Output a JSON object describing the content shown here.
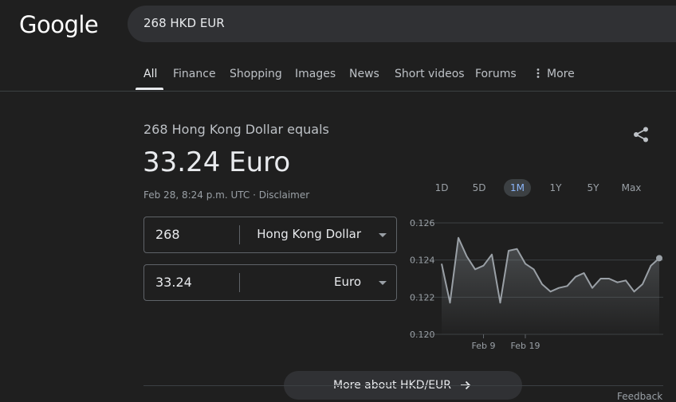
{
  "logo": "Google",
  "search": {
    "value": "268 HKD EUR"
  },
  "tabs": {
    "all": "All",
    "finance": "Finance",
    "shopping": "Shopping",
    "images": "Images",
    "news": "News",
    "short_videos": "Short videos",
    "forums": "Forums",
    "more": "More"
  },
  "converter": {
    "equals_line": "268 Hong Kong Dollar equals",
    "result": "33.24 Euro",
    "meta": "Feb 28, 8:24 p.m. UTC · Disclaimer",
    "from": {
      "amount": "268",
      "currency": "Hong Kong Dollar"
    },
    "to": {
      "amount": "33.24",
      "currency": "Euro"
    }
  },
  "ranges": [
    "1D",
    "5D",
    "1M",
    "1Y",
    "5Y",
    "Max"
  ],
  "active_range": "1M",
  "chart_data": {
    "type": "area",
    "y_ticks": [
      "0.126",
      "0.124",
      "0.122",
      "0.120"
    ],
    "x_ticks": [
      "Feb 9",
      "Feb 19"
    ],
    "ylim": [
      0.12,
      0.126
    ],
    "grid": true,
    "values": [
      0.1238,
      0.1217,
      0.1252,
      0.1242,
      0.1235,
      0.1237,
      0.1243,
      0.1217,
      0.1245,
      0.1246,
      0.1238,
      0.1235,
      0.1227,
      0.1223,
      0.1225,
      0.1226,
      0.1231,
      0.1233,
      0.1225,
      0.123,
      0.123,
      0.1228,
      0.1229,
      0.1223,
      0.1227,
      0.1237,
      0.1241
    ]
  },
  "colors": {
    "accent": "#8ab4f8",
    "chart_line": "#9aa0a6",
    "background": "#1f1f1f"
  },
  "more_button": "More about HKD/EUR",
  "feedback": "Feedback"
}
